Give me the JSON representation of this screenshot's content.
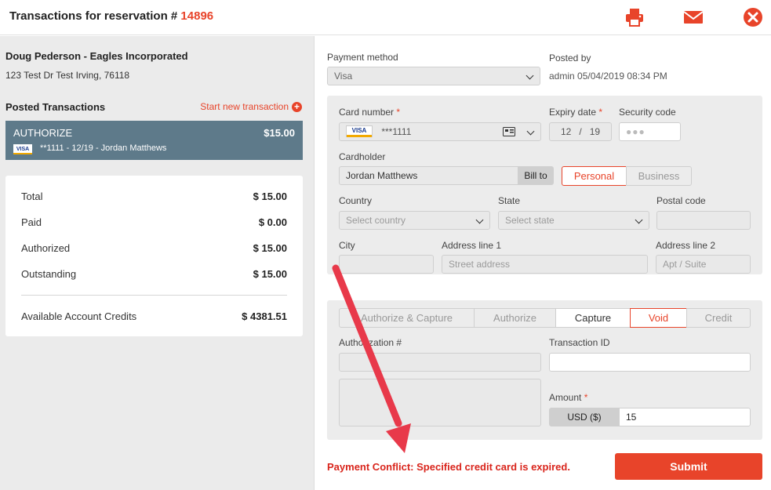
{
  "header": {
    "title_prefix": "Transactions for reservation #",
    "reservation_number": "14896"
  },
  "guest": {
    "name": "Doug Pederson - Eagles Incorporated",
    "address": "123 Test Dr Test Irving, 76118"
  },
  "posted": {
    "label": "Posted Transactions",
    "start_new": "Start new transaction",
    "transaction": {
      "type": "AUTHORIZE",
      "amount": "$15.00",
      "detail": "**1111 - 12/19 - Jordan Matthews",
      "card_brand": "VISA"
    }
  },
  "summary": {
    "rows": [
      {
        "label": "Total",
        "value": "$ 15.00"
      },
      {
        "label": "Paid",
        "value": "$ 0.00"
      },
      {
        "label": "Authorized",
        "value": "$ 15.00"
      },
      {
        "label": "Outstanding",
        "value": "$ 15.00"
      }
    ],
    "credits_label": "Available Account Credits",
    "credits_value": "$ 4381.51"
  },
  "payment": {
    "method_label": "Payment method",
    "method_value": "Visa",
    "posted_by_label": "Posted by",
    "posted_by_value": "admin 05/04/2019 08:34 PM"
  },
  "card": {
    "number_label": "Card number",
    "number_value": "***1111",
    "brand": "VISA",
    "expiry_label": "Expiry date",
    "expiry_month": "12",
    "expiry_sep": "/",
    "expiry_year": "19",
    "security_label": "Security code",
    "security_placeholder": "●●●",
    "cardholder_label": "Cardholder",
    "cardholder_value": "Jordan Matthews",
    "bill_to": "Bill to",
    "personal": "Personal",
    "business": "Business",
    "country_label": "Country",
    "country_placeholder": "Select country",
    "state_label": "State",
    "state_placeholder": "Select state",
    "postal_label": "Postal code",
    "city_label": "City",
    "address1_label": "Address line 1",
    "address1_placeholder": "Street address",
    "address2_label": "Address line 2",
    "address2_placeholder": "Apt / Suite"
  },
  "action": {
    "tabs": [
      "Authorize & Capture",
      "Authorize",
      "Capture",
      "Void",
      "Credit"
    ],
    "auth_label": "Authorization #",
    "txn_id_label": "Transaction ID",
    "amount_label": "Amount",
    "currency": "USD ($)",
    "amount_value": "15"
  },
  "error_message": "Payment Conflict: Specified credit card is expired.",
  "submit_label": "Submit",
  "colors": {
    "accent": "#e8442a",
    "txn_bg": "#5e7a8a",
    "error": "#d9251c"
  }
}
